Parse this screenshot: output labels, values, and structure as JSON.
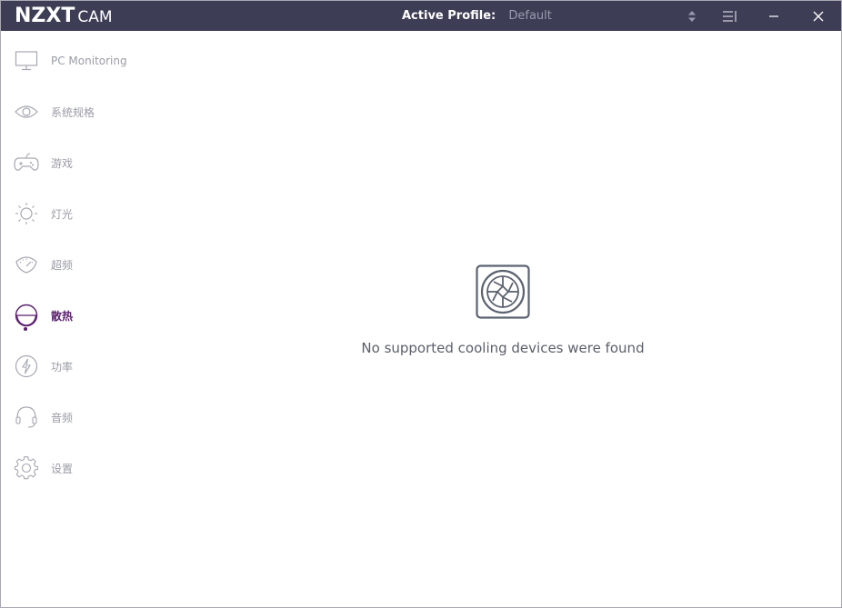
{
  "app": {
    "brand": "NZXT",
    "product": "CAM"
  },
  "titlebar": {
    "profile_label": "Active Profile:",
    "profile_value": "Default",
    "icons": [
      "sort-icon",
      "menu-icon",
      "minimize-icon",
      "close-icon"
    ]
  },
  "sidebar": {
    "items": [
      {
        "label": "PC Monitoring",
        "icon": "monitor-icon",
        "active": false
      },
      {
        "label": "系统规格",
        "icon": "eye-icon",
        "active": false
      },
      {
        "label": "游戏",
        "icon": "gamepad-icon",
        "active": false
      },
      {
        "label": "灯光",
        "icon": "sun-icon",
        "active": false
      },
      {
        "label": "超频",
        "icon": "gauge-icon",
        "active": false
      },
      {
        "label": "散热",
        "icon": "cooling-icon",
        "active": true
      },
      {
        "label": "功率",
        "icon": "lightning-icon",
        "active": false
      },
      {
        "label": "音频",
        "icon": "headset-icon",
        "active": false
      },
      {
        "label": "设置",
        "icon": "gear-icon",
        "active": false
      }
    ]
  },
  "main": {
    "empty_message": "No supported cooling devices were found",
    "empty_icon": "fan-icon"
  },
  "colors": {
    "titlebar": "#3d3e55",
    "accent": "#5a1f6e",
    "nav_text": "#9b9ca6",
    "message_text": "#5c5f6b"
  }
}
